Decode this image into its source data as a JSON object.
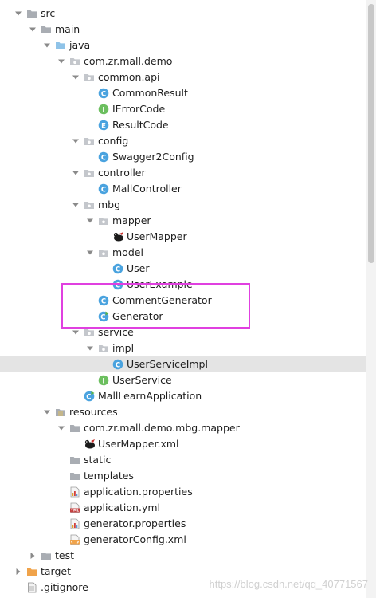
{
  "tree": {
    "items": [
      {
        "label": "src",
        "icon": "folder",
        "arrow": "down",
        "depth": 0
      },
      {
        "label": "main",
        "icon": "folder",
        "arrow": "down",
        "depth": 1
      },
      {
        "label": "java",
        "icon": "folder-source",
        "arrow": "down",
        "depth": 2
      },
      {
        "label": "com.zr.mall.demo",
        "icon": "package",
        "arrow": "down",
        "depth": 3
      },
      {
        "label": "common.api",
        "icon": "package",
        "arrow": "down",
        "depth": 4
      },
      {
        "label": "CommonResult",
        "icon": "class",
        "arrow": "none",
        "depth": 5
      },
      {
        "label": "IErrorCode",
        "icon": "interface",
        "arrow": "none",
        "depth": 5
      },
      {
        "label": "ResultCode",
        "icon": "enum",
        "arrow": "none",
        "depth": 5
      },
      {
        "label": "config",
        "icon": "package",
        "arrow": "down",
        "depth": 4
      },
      {
        "label": "Swagger2Config",
        "icon": "class",
        "arrow": "none",
        "depth": 5
      },
      {
        "label": "controller",
        "icon": "package",
        "arrow": "down",
        "depth": 4
      },
      {
        "label": "MallController",
        "icon": "class",
        "arrow": "none",
        "depth": 5
      },
      {
        "label": "mbg",
        "icon": "package",
        "arrow": "down",
        "depth": 4
      },
      {
        "label": "mapper",
        "icon": "package",
        "arrow": "down",
        "depth": 5
      },
      {
        "label": "UserMapper",
        "icon": "mybatis",
        "arrow": "none",
        "depth": 6
      },
      {
        "label": "model",
        "icon": "package",
        "arrow": "down",
        "depth": 5
      },
      {
        "label": "User",
        "icon": "class",
        "arrow": "none",
        "depth": 6
      },
      {
        "label": "UserExample",
        "icon": "class",
        "arrow": "none",
        "depth": 6
      },
      {
        "label": "CommentGenerator",
        "icon": "class",
        "arrow": "none",
        "depth": 5
      },
      {
        "label": "Generator",
        "icon": "class-run",
        "arrow": "none",
        "depth": 5
      },
      {
        "label": "service",
        "icon": "package",
        "arrow": "down",
        "depth": 4
      },
      {
        "label": "impl",
        "icon": "package",
        "arrow": "down",
        "depth": 5
      },
      {
        "label": "UserServiceImpl",
        "icon": "class",
        "arrow": "none",
        "depth": 6,
        "selected": true
      },
      {
        "label": "UserService",
        "icon": "interface",
        "arrow": "none",
        "depth": 5
      },
      {
        "label": "MallLearnApplication",
        "icon": "class-run",
        "arrow": "none",
        "depth": 4
      },
      {
        "label": "resources",
        "icon": "folder-resources",
        "arrow": "down",
        "depth": 2
      },
      {
        "label": "com.zr.mall.demo.mbg.mapper",
        "icon": "folder",
        "arrow": "down",
        "depth": 3
      },
      {
        "label": "UserMapper.xml",
        "icon": "mybatis",
        "arrow": "none",
        "depth": 4
      },
      {
        "label": "static",
        "icon": "folder",
        "arrow": "none",
        "depth": 3
      },
      {
        "label": "templates",
        "icon": "folder",
        "arrow": "none",
        "depth": 3
      },
      {
        "label": "application.properties",
        "icon": "properties",
        "arrow": "none",
        "depth": 3
      },
      {
        "label": "application.yml",
        "icon": "yml",
        "arrow": "none",
        "depth": 3
      },
      {
        "label": "generator.properties",
        "icon": "properties",
        "arrow": "none",
        "depth": 3
      },
      {
        "label": "generatorConfig.xml",
        "icon": "xml",
        "arrow": "none",
        "depth": 3
      },
      {
        "label": "test",
        "icon": "folder",
        "arrow": "right",
        "depth": 1
      },
      {
        "label": "target",
        "icon": "folder-excluded",
        "arrow": "right",
        "depth": 0
      },
      {
        "label": ".gitignore",
        "icon": "file",
        "arrow": "none",
        "depth": 0
      }
    ]
  },
  "watermark": "https://blog.csdn.net/qq_40771567",
  "colors": {
    "folder": "#a9adb3",
    "folder_source": "#8fc3e8",
    "folder_resources": "#b9b27a",
    "folder_excluded": "#f0a34a",
    "class": "#4aa3df",
    "interface": "#6cbf5f",
    "enum": "#4aa3df",
    "highlight": "#e040e0",
    "selected": "#e4e4e4"
  }
}
